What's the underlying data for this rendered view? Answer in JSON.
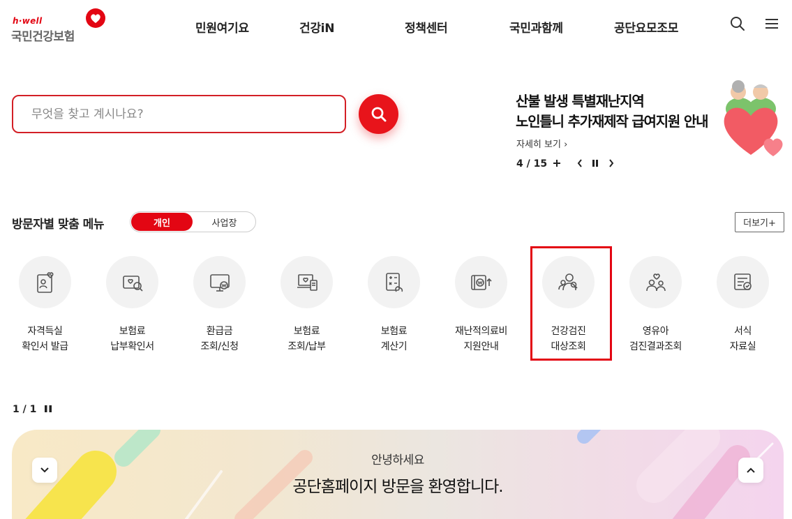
{
  "logo": {
    "sub": "h·well",
    "main": "국민건강보험"
  },
  "nav": [
    "민원여기요",
    "건강iN",
    "정책센터",
    "국민과함께",
    "공단요모조모"
  ],
  "search": {
    "placeholder": "무엇을 찾고 계시나요?"
  },
  "banner": {
    "title_line1": "산불 발생 특별재난지역",
    "title_line2": "노인틀니 추가재제작 급여지원 안내",
    "more_label": "자세히 보기 ›",
    "counter": "4 / 15"
  },
  "custom_menu": {
    "title": "방문자별 맞춤 메뉴",
    "toggle_on": "개인",
    "toggle_off": "사업장",
    "more_label": "더보기+",
    "items": [
      {
        "label": "자격득실\n확인서 발급",
        "icon": "document-person-heart-icon"
      },
      {
        "label": "보험료\n납부확인서",
        "icon": "card-search-icon"
      },
      {
        "label": "환급금\n조회/신청",
        "icon": "monitor-won-icon"
      },
      {
        "label": "보험료\n조회/납부",
        "icon": "laptop-receipt-icon"
      },
      {
        "label": "보험료\n계산기",
        "icon": "calculator-hand-icon"
      },
      {
        "label": "재난적의료비\n지원안내",
        "icon": "wallet-won-arrow-icon"
      },
      {
        "label": "건강검진\n대상조회",
        "icon": "people-search-icon"
      },
      {
        "label": "영유아\n검진결과조회",
        "icon": "family-heart-icon"
      },
      {
        "label": "서식\n자료실",
        "icon": "form-search-icon"
      }
    ],
    "pager": "1 / 1"
  },
  "welcome": {
    "sub": "안녕하세요",
    "title": "공단홈페이지 방문을 환영합니다."
  },
  "colors": {
    "brand_red": "#e30613",
    "search_btn": "#e8141b",
    "icon_stroke": "#555555",
    "circle_bg": "#f2f2f2"
  }
}
